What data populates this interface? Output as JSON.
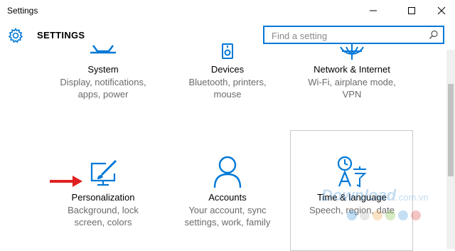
{
  "window": {
    "title": "Settings",
    "minimize_icon": "minimize-icon",
    "maximize_icon": "maximize-icon",
    "close_icon": "close-icon"
  },
  "header": {
    "app_title": "SETTINGS",
    "icon": "gear-icon"
  },
  "search": {
    "placeholder": "Find a setting",
    "value": "",
    "icon": "search-icon"
  },
  "accent_color": "#0078d7",
  "tiles": [
    {
      "name": "System",
      "desc": "Display, notifications,\napps, power",
      "icon": "monitor-icon"
    },
    {
      "name": "Devices",
      "desc": "Bluetooth, printers,\nmouse",
      "icon": "keyboard-speaker-icon"
    },
    {
      "name": "Network & Internet",
      "desc": "Wi-Fi, airplane mode,\nVPN",
      "icon": "globe-icon"
    },
    {
      "name": "Personalization",
      "desc": "Background, lock\nscreen, colors",
      "icon": "paintbrush-monitor-icon"
    },
    {
      "name": "Accounts",
      "desc": "Your account, sync\nsettings, work, family",
      "icon": "person-icon"
    },
    {
      "name": "Time & language",
      "desc": "Speech, region, date",
      "icon": "clock-language-icon"
    }
  ],
  "watermark": {
    "text": "Download",
    "suffix": ".com.vn"
  }
}
